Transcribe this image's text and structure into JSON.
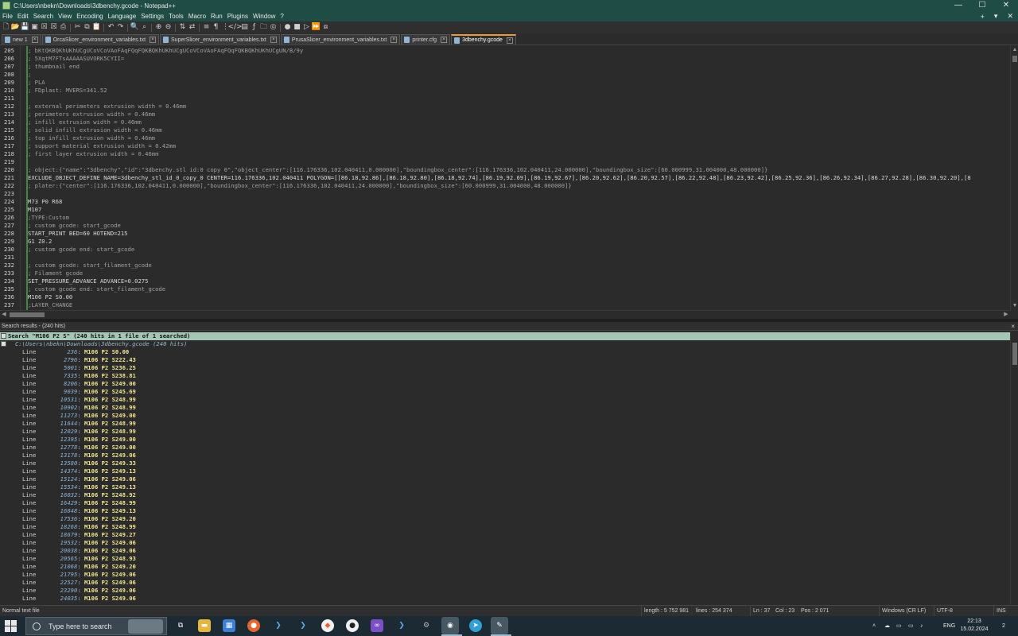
{
  "window": {
    "title": "C:\\Users\\nbekn\\Downloads\\3dbenchy.gcode - Notepad++",
    "controls": {
      "minimize": "—",
      "maximize": "☐",
      "close": "✕"
    }
  },
  "menu": [
    "File",
    "Edit",
    "Search",
    "View",
    "Encoding",
    "Language",
    "Settings",
    "Tools",
    "Macro",
    "Run",
    "Plugins",
    "Window",
    "?"
  ],
  "menu_right": {
    "plus": "+",
    "down": "▾",
    "close": "✕"
  },
  "tabs": [
    {
      "label": "new 1",
      "active": false
    },
    {
      "label": "OrcaSlicer_environment_variables.txt",
      "active": false
    },
    {
      "label": "SuperSlicer_environment_variables.txt",
      "active": false
    },
    {
      "label": "PrusaSlicer_environment_variables.txt",
      "active": false
    },
    {
      "label": "printer.cfg",
      "active": false
    },
    {
      "label": "3dbenchy.gcode",
      "active": true
    }
  ],
  "editor": {
    "lines": [
      {
        "n": "205",
        "text": "; bKtQKBQKhUKhUCgUCoVCoVAoFAqFQqFQKBQKhUKhUCgUCoVCoVAoFAqFQqFQKBQKhUKhUCgUN/B/9y"
      },
      {
        "n": "206",
        "text": "; 5XqtM7FTsAAAAASUVORK5CYII="
      },
      {
        "n": "207",
        "text": "; thumbnail end"
      },
      {
        "n": "208",
        "text": ";"
      },
      {
        "n": "209",
        "text": "; PLA"
      },
      {
        "n": "210",
        "text": "; FDplast: MVERS=341.52"
      },
      {
        "n": "211",
        "text": ""
      },
      {
        "n": "212",
        "text": "; external perimeters extrusion width = 0.46mm"
      },
      {
        "n": "213",
        "text": "; perimeters extrusion width = 0.46mm"
      },
      {
        "n": "214",
        "text": "; infill extrusion width = 0.46mm"
      },
      {
        "n": "215",
        "text": "; solid infill extrusion width = 0.46mm"
      },
      {
        "n": "216",
        "text": "; top infill extrusion width = 0.46mm"
      },
      {
        "n": "217",
        "text": "; support material extrusion width = 0.42mm"
      },
      {
        "n": "218",
        "text": "; first layer extrusion width = 0.46mm"
      },
      {
        "n": "219",
        "text": ""
      },
      {
        "n": "220",
        "text": "; object:{\"name\":\"3dbenchy\",\"id\":\"3dbenchy.stl id:0 copy 0\",\"object_center\":[116.176336,102.040411,0.000000],\"boundingbox_center\":[116.176336,102.040411,24.000000],\"boundingbox_size\":[60.000999,31.004000,48.000000]}"
      },
      {
        "n": "221",
        "text": "EXCLUDE_OBJECT_DEFINE NAME=3dbenchy_stl_id_0_copy_0 CENTER=116.176336,102.040411 POLYGON=[[86.18,92.86],[86.18,92.80],[86.18,92.74],[86.19,92.69],[86.19,92.67],[86.20,92.62],[86.20,92.57],[86.22,92.48],[86.23,92.42],[86.25,92.36],[86.26,92.34],[86.27,92.28],[86.30,92.20],[8"
      },
      {
        "n": "222",
        "text": "; plater:{\"center\":[116.176336,102.040411,0.000000],\"boundingbox_center\":[116.176336,102.040411,24.000000],\"boundingbox_size\":[60.000999,31.004000,48.000000]}"
      },
      {
        "n": "223",
        "text": ""
      },
      {
        "n": "224",
        "text": "M73 P0 R68"
      },
      {
        "n": "225",
        "text": "M107"
      },
      {
        "n": "226",
        "text": ";TYPE:Custom"
      },
      {
        "n": "227",
        "text": "; custom gcode: start_gcode"
      },
      {
        "n": "228",
        "text": "START_PRINT BED=60 HOTEND=215"
      },
      {
        "n": "229",
        "text": "G1 Z0.2"
      },
      {
        "n": "230",
        "text": "; custom gcode end: start_gcode"
      },
      {
        "n": "231",
        "text": ""
      },
      {
        "n": "232",
        "text": "; custom gcode: start_filament_gcode"
      },
      {
        "n": "233",
        "text": "; Filament gcode"
      },
      {
        "n": "234",
        "text": "SET_PRESSURE_ADVANCE ADVANCE=0.0275"
      },
      {
        "n": "235",
        "text": "; custom gcode end: start_filament_gcode"
      },
      {
        "n": "236",
        "text": "M106 P2 S0.00"
      },
      {
        "n": "237",
        "text": ";LAYER_CHANGE"
      }
    ]
  },
  "search_panel": {
    "title": "Search results - (240 hits)",
    "close": "×",
    "header": "Search \"M106 P2 S\" (240 hits in 1 file of 1 searched)",
    "file": "C:\\Users\\nbekn\\Downloads\\3dbenchy.gcode (240 hits)",
    "hit_label": "Line",
    "hit_keyword": "M106 P2",
    "hits": [
      {
        "line": "236",
        "value": "S0.00"
      },
      {
        "line": "2796",
        "value": "S222.43"
      },
      {
        "line": "5001",
        "value": "S236.25"
      },
      {
        "line": "7335",
        "value": "S238.81"
      },
      {
        "line": "8206",
        "value": "S249.00"
      },
      {
        "line": "9039",
        "value": "S245.69"
      },
      {
        "line": "10531",
        "value": "S248.99"
      },
      {
        "line": "10902",
        "value": "S248.99"
      },
      {
        "line": "11273",
        "value": "S249.00"
      },
      {
        "line": "11644",
        "value": "S248.99"
      },
      {
        "line": "12029",
        "value": "S248.99"
      },
      {
        "line": "12395",
        "value": "S249.00"
      },
      {
        "line": "12778",
        "value": "S249.00"
      },
      {
        "line": "13178",
        "value": "S249.06"
      },
      {
        "line": "13580",
        "value": "S249.33"
      },
      {
        "line": "14374",
        "value": "S249.13"
      },
      {
        "line": "15124",
        "value": "S249.06"
      },
      {
        "line": "15534",
        "value": "S249.13"
      },
      {
        "line": "16032",
        "value": "S248.92"
      },
      {
        "line": "16429",
        "value": "S248.99"
      },
      {
        "line": "16848",
        "value": "S249.13"
      },
      {
        "line": "17536",
        "value": "S249.20"
      },
      {
        "line": "18268",
        "value": "S248.99"
      },
      {
        "line": "18679",
        "value": "S249.27"
      },
      {
        "line": "19532",
        "value": "S249.06"
      },
      {
        "line": "20038",
        "value": "S249.06"
      },
      {
        "line": "20565",
        "value": "S248.93"
      },
      {
        "line": "21068",
        "value": "S249.20"
      },
      {
        "line": "21795",
        "value": "S249.06"
      },
      {
        "line": "22527",
        "value": "S249.06"
      },
      {
        "line": "23290",
        "value": "S249.06"
      },
      {
        "line": "24035",
        "value": "S249.06"
      }
    ]
  },
  "statusbar": {
    "filetype": "Normal text file",
    "length": "length : 5 752 981",
    "lines": "lines : 254 374",
    "ln": "Ln : 37",
    "col": "Col : 23",
    "pos": "Pos : 2 071",
    "eol": "Windows (CR LF)",
    "encoding": "UTF-8",
    "mode": "INS"
  },
  "taskbar": {
    "search_placeholder": "Type here to search",
    "language": "ENG",
    "time": "22:13",
    "date": "15.02.2024",
    "notifications": "2"
  },
  "colors": {
    "titlebar": "#1f4d45",
    "search_header": "#a4c7b5",
    "active_tab_accent": "#e69b3a",
    "change_bar": "#3d8a3d"
  }
}
